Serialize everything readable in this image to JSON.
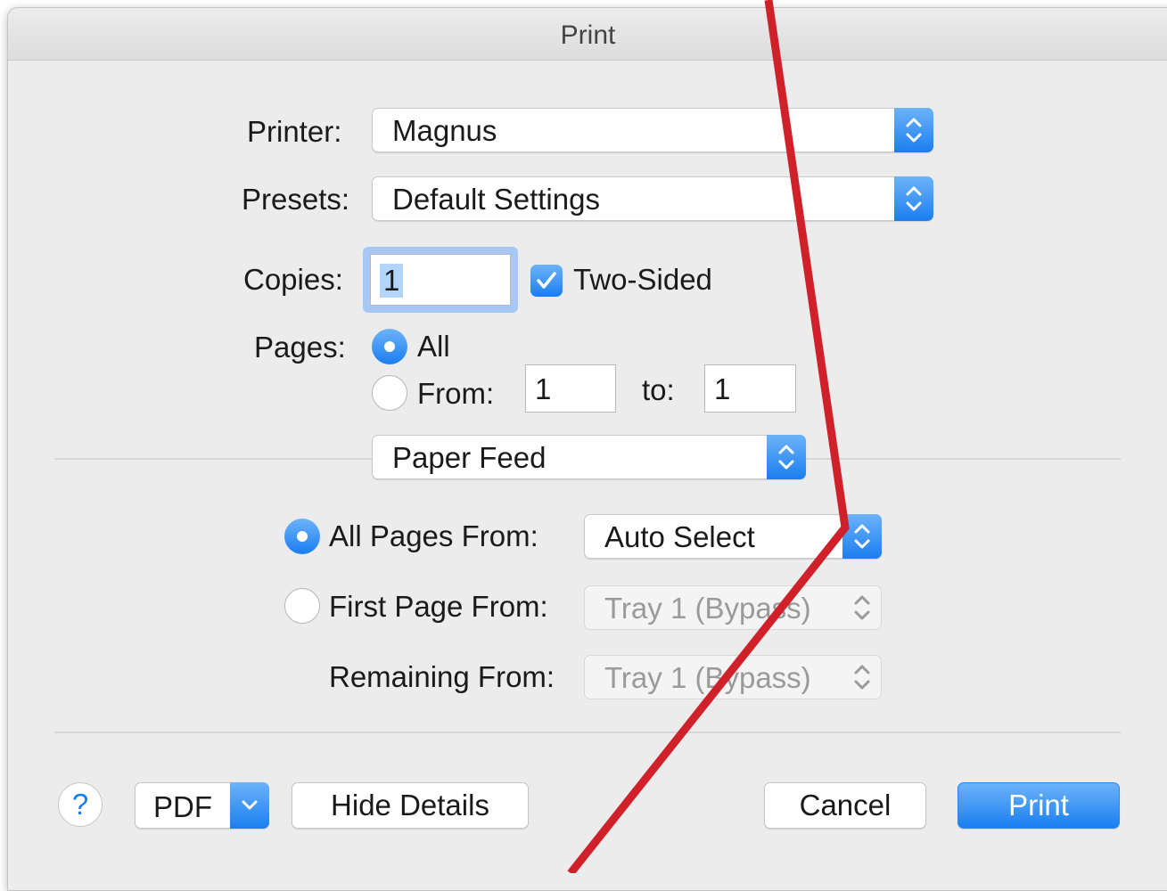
{
  "window": {
    "title": "Print"
  },
  "printer": {
    "label": "Printer:",
    "value": "Magnus"
  },
  "presets": {
    "label": "Presets:",
    "value": "Default Settings"
  },
  "copies": {
    "label": "Copies:",
    "value": "1",
    "two_sided_label": "Two-Sided",
    "two_sided_checked": true
  },
  "pages": {
    "label": "Pages:",
    "all_label": "All",
    "from_label": "From:",
    "from_value": "1",
    "to_label": "to:",
    "to_value": "1",
    "selected": "All"
  },
  "section_popup": {
    "value": "Paper Feed"
  },
  "paper_feed": {
    "all_pages_label": "All Pages From:",
    "all_pages_value": "Auto Select",
    "first_page_label": "First Page From:",
    "first_page_value": "Tray 1 (Bypass)",
    "remaining_label": "Remaining From:",
    "remaining_value": "Tray 1 (Bypass)",
    "selected": "All Pages From:"
  },
  "footer": {
    "help_label": "?",
    "pdf_label": "PDF",
    "hide_details_label": "Hide Details",
    "cancel_label": "Cancel",
    "print_label": "Print"
  },
  "colors": {
    "accent": "#1b7ef0",
    "annotation_line": "#d0202a"
  }
}
